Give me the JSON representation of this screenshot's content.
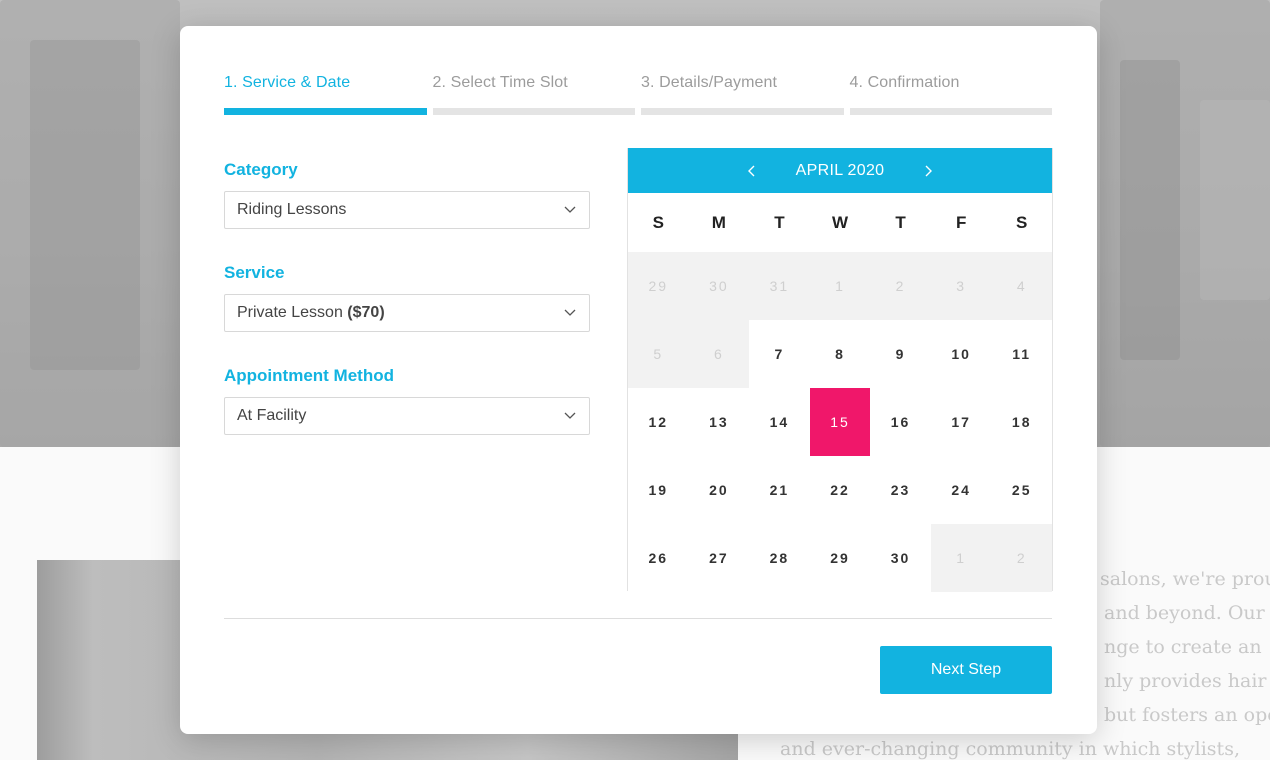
{
  "background_text": [
    "salons, we're proud",
    "and beyond. Our",
    "nge to create an",
    "nly provides hair",
    "but fosters an open",
    "and ever-changing community in which stylists,"
  ],
  "steps": [
    {
      "label": "1. Service & Date",
      "active": true
    },
    {
      "label": "2. Select Time Slot",
      "active": false
    },
    {
      "label": "3. Details/Payment",
      "active": false
    },
    {
      "label": "4. Confirmation",
      "active": false
    }
  ],
  "form": {
    "category": {
      "label": "Category",
      "value": "Riding Lessons"
    },
    "service": {
      "label": "Service",
      "value_name": "Private Lesson",
      "value_price": "($70)"
    },
    "method": {
      "label": "Appointment Method",
      "value": "At Facility"
    }
  },
  "calendar": {
    "month_label": "APRIL 2020",
    "weekdays": [
      "S",
      "M",
      "T",
      "W",
      "T",
      "F",
      "S"
    ],
    "selected_day": "15",
    "weeks": [
      [
        {
          "d": "29",
          "m": true
        },
        {
          "d": "30",
          "m": true
        },
        {
          "d": "31",
          "m": true
        },
        {
          "d": "1",
          "m": true
        },
        {
          "d": "2",
          "m": true
        },
        {
          "d": "3",
          "m": true
        },
        {
          "d": "4",
          "m": true
        }
      ],
      [
        {
          "d": "5",
          "m": true
        },
        {
          "d": "6",
          "m": true
        },
        {
          "d": "7",
          "m": false
        },
        {
          "d": "8",
          "m": false
        },
        {
          "d": "9",
          "m": false
        },
        {
          "d": "10",
          "m": false
        },
        {
          "d": "11",
          "m": false
        }
      ],
      [
        {
          "d": "12",
          "m": false
        },
        {
          "d": "13",
          "m": false
        },
        {
          "d": "14",
          "m": false
        },
        {
          "d": "15",
          "m": false
        },
        {
          "d": "16",
          "m": false
        },
        {
          "d": "17",
          "m": false
        },
        {
          "d": "18",
          "m": false
        }
      ],
      [
        {
          "d": "19",
          "m": false
        },
        {
          "d": "20",
          "m": false
        },
        {
          "d": "21",
          "m": false
        },
        {
          "d": "22",
          "m": false
        },
        {
          "d": "23",
          "m": false
        },
        {
          "d": "24",
          "m": false
        },
        {
          "d": "25",
          "m": false
        }
      ],
      [
        {
          "d": "26",
          "m": false
        },
        {
          "d": "27",
          "m": false
        },
        {
          "d": "28",
          "m": false
        },
        {
          "d": "29",
          "m": false
        },
        {
          "d": "30",
          "m": false
        },
        {
          "d": "1",
          "m": true
        },
        {
          "d": "2",
          "m": true
        }
      ]
    ]
  },
  "next_button": "Next Step",
  "colors": {
    "accent": "#12b3e0",
    "selected": "#f0176a",
    "muted_cell": "#f2f2f2"
  }
}
